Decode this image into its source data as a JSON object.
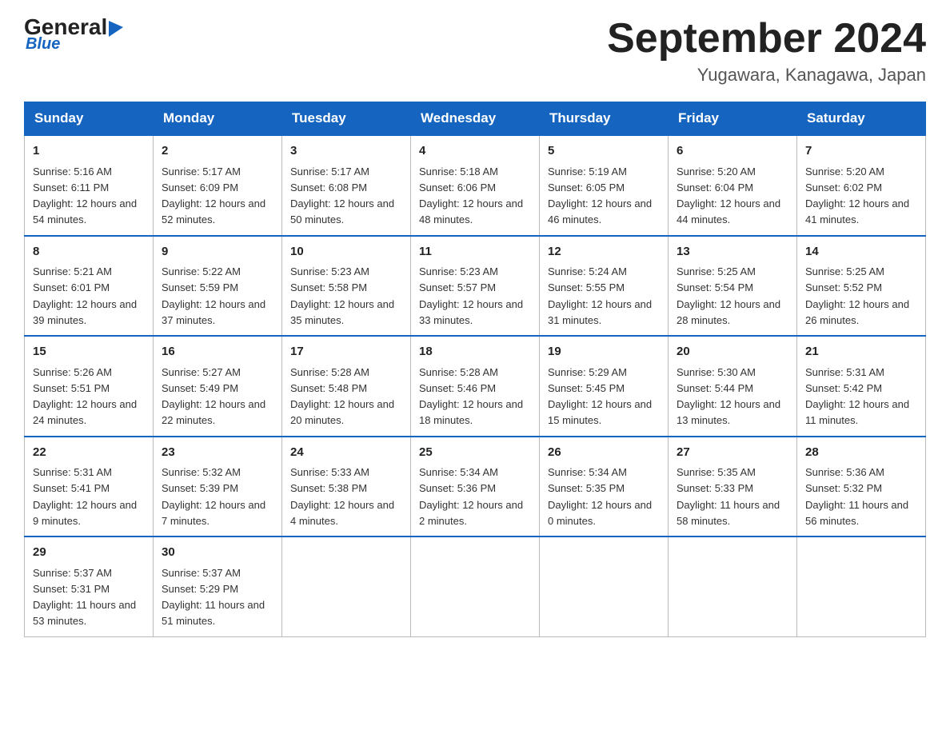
{
  "logo": {
    "brand": "General",
    "brand2": "Blue"
  },
  "header": {
    "month": "September 2024",
    "location": "Yugawara, Kanagawa, Japan"
  },
  "weekdays": [
    "Sunday",
    "Monday",
    "Tuesday",
    "Wednesday",
    "Thursday",
    "Friday",
    "Saturday"
  ],
  "weeks": [
    [
      {
        "day": "1",
        "sunrise": "5:16 AM",
        "sunset": "6:11 PM",
        "daylight": "12 hours and 54 minutes."
      },
      {
        "day": "2",
        "sunrise": "5:17 AM",
        "sunset": "6:09 PM",
        "daylight": "12 hours and 52 minutes."
      },
      {
        "day": "3",
        "sunrise": "5:17 AM",
        "sunset": "6:08 PM",
        "daylight": "12 hours and 50 minutes."
      },
      {
        "day": "4",
        "sunrise": "5:18 AM",
        "sunset": "6:06 PM",
        "daylight": "12 hours and 48 minutes."
      },
      {
        "day": "5",
        "sunrise": "5:19 AM",
        "sunset": "6:05 PM",
        "daylight": "12 hours and 46 minutes."
      },
      {
        "day": "6",
        "sunrise": "5:20 AM",
        "sunset": "6:04 PM",
        "daylight": "12 hours and 44 minutes."
      },
      {
        "day": "7",
        "sunrise": "5:20 AM",
        "sunset": "6:02 PM",
        "daylight": "12 hours and 41 minutes."
      }
    ],
    [
      {
        "day": "8",
        "sunrise": "5:21 AM",
        "sunset": "6:01 PM",
        "daylight": "12 hours and 39 minutes."
      },
      {
        "day": "9",
        "sunrise": "5:22 AM",
        "sunset": "5:59 PM",
        "daylight": "12 hours and 37 minutes."
      },
      {
        "day": "10",
        "sunrise": "5:23 AM",
        "sunset": "5:58 PM",
        "daylight": "12 hours and 35 minutes."
      },
      {
        "day": "11",
        "sunrise": "5:23 AM",
        "sunset": "5:57 PM",
        "daylight": "12 hours and 33 minutes."
      },
      {
        "day": "12",
        "sunrise": "5:24 AM",
        "sunset": "5:55 PM",
        "daylight": "12 hours and 31 minutes."
      },
      {
        "day": "13",
        "sunrise": "5:25 AM",
        "sunset": "5:54 PM",
        "daylight": "12 hours and 28 minutes."
      },
      {
        "day": "14",
        "sunrise": "5:25 AM",
        "sunset": "5:52 PM",
        "daylight": "12 hours and 26 minutes."
      }
    ],
    [
      {
        "day": "15",
        "sunrise": "5:26 AM",
        "sunset": "5:51 PM",
        "daylight": "12 hours and 24 minutes."
      },
      {
        "day": "16",
        "sunrise": "5:27 AM",
        "sunset": "5:49 PM",
        "daylight": "12 hours and 22 minutes."
      },
      {
        "day": "17",
        "sunrise": "5:28 AM",
        "sunset": "5:48 PM",
        "daylight": "12 hours and 20 minutes."
      },
      {
        "day": "18",
        "sunrise": "5:28 AM",
        "sunset": "5:46 PM",
        "daylight": "12 hours and 18 minutes."
      },
      {
        "day": "19",
        "sunrise": "5:29 AM",
        "sunset": "5:45 PM",
        "daylight": "12 hours and 15 minutes."
      },
      {
        "day": "20",
        "sunrise": "5:30 AM",
        "sunset": "5:44 PM",
        "daylight": "12 hours and 13 minutes."
      },
      {
        "day": "21",
        "sunrise": "5:31 AM",
        "sunset": "5:42 PM",
        "daylight": "12 hours and 11 minutes."
      }
    ],
    [
      {
        "day": "22",
        "sunrise": "5:31 AM",
        "sunset": "5:41 PM",
        "daylight": "12 hours and 9 minutes."
      },
      {
        "day": "23",
        "sunrise": "5:32 AM",
        "sunset": "5:39 PM",
        "daylight": "12 hours and 7 minutes."
      },
      {
        "day": "24",
        "sunrise": "5:33 AM",
        "sunset": "5:38 PM",
        "daylight": "12 hours and 4 minutes."
      },
      {
        "day": "25",
        "sunrise": "5:34 AM",
        "sunset": "5:36 PM",
        "daylight": "12 hours and 2 minutes."
      },
      {
        "day": "26",
        "sunrise": "5:34 AM",
        "sunset": "5:35 PM",
        "daylight": "12 hours and 0 minutes."
      },
      {
        "day": "27",
        "sunrise": "5:35 AM",
        "sunset": "5:33 PM",
        "daylight": "11 hours and 58 minutes."
      },
      {
        "day": "28",
        "sunrise": "5:36 AM",
        "sunset": "5:32 PM",
        "daylight": "11 hours and 56 minutes."
      }
    ],
    [
      {
        "day": "29",
        "sunrise": "5:37 AM",
        "sunset": "5:31 PM",
        "daylight": "11 hours and 53 minutes."
      },
      {
        "day": "30",
        "sunrise": "5:37 AM",
        "sunset": "5:29 PM",
        "daylight": "11 hours and 51 minutes."
      },
      null,
      null,
      null,
      null,
      null
    ]
  ]
}
